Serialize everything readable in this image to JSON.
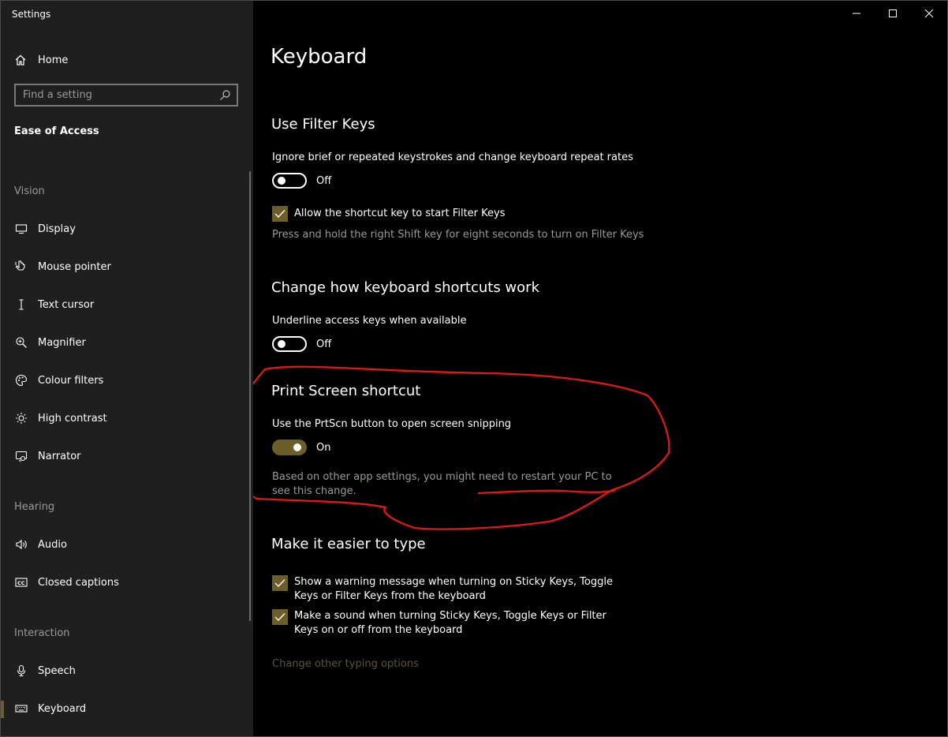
{
  "window": {
    "title": "Settings"
  },
  "sidebar": {
    "home_label": "Home",
    "search_placeholder": "Find a setting",
    "section_title": "Ease of Access",
    "groups": [
      {
        "label": "Vision"
      },
      {
        "label": "Hearing"
      },
      {
        "label": "Interaction"
      }
    ],
    "items": [
      {
        "label": "Display",
        "icon": "display-icon"
      },
      {
        "label": "Mouse pointer",
        "icon": "mouse-pointer-icon"
      },
      {
        "label": "Text cursor",
        "icon": "text-cursor-icon"
      },
      {
        "label": "Magnifier",
        "icon": "magnifier-icon"
      },
      {
        "label": "Colour filters",
        "icon": "colour-filters-icon"
      },
      {
        "label": "High contrast",
        "icon": "high-contrast-icon"
      },
      {
        "label": "Narrator",
        "icon": "narrator-icon"
      },
      {
        "label": "Audio",
        "icon": "audio-icon"
      },
      {
        "label": "Closed captions",
        "icon": "closed-captions-icon"
      },
      {
        "label": "Speech",
        "icon": "microphone-icon"
      },
      {
        "label": "Keyboard",
        "icon": "keyboard-icon",
        "active": true
      }
    ]
  },
  "main": {
    "title": "Keyboard",
    "filter_keys": {
      "heading": "Use Filter Keys",
      "description": "Ignore brief or repeated keystrokes and change keyboard repeat rates",
      "toggle_state": "Off",
      "checkbox_label": "Allow the shortcut key to start Filter Keys",
      "checkbox_checked": true,
      "note": "Press and hold the right Shift key for eight seconds to turn on Filter Keys"
    },
    "shortcuts": {
      "heading": "Change how keyboard shortcuts work",
      "description": "Underline access keys when available",
      "toggle_state": "Off"
    },
    "print_screen": {
      "heading": "Print Screen shortcut",
      "description": "Use the PrtScn button to open screen snipping",
      "toggle_state": "On",
      "note": "Based on other app settings, you might need to restart your PC to see this change."
    },
    "typing": {
      "heading": "Make it easier to type",
      "checkbox1_label": "Show a warning message when turning on Sticky Keys, Toggle Keys or Filter Keys from the keyboard",
      "checkbox1_checked": true,
      "checkbox2_label": "Make a sound when turning Sticky Keys, Toggle Keys or Filter Keys on or off from the keyboard",
      "checkbox2_checked": true,
      "link": "Change other typing options"
    }
  },
  "colors": {
    "accent": "#6b5e28",
    "annotation": "#e01818",
    "sidebar_bg": "#1f1f1f"
  }
}
